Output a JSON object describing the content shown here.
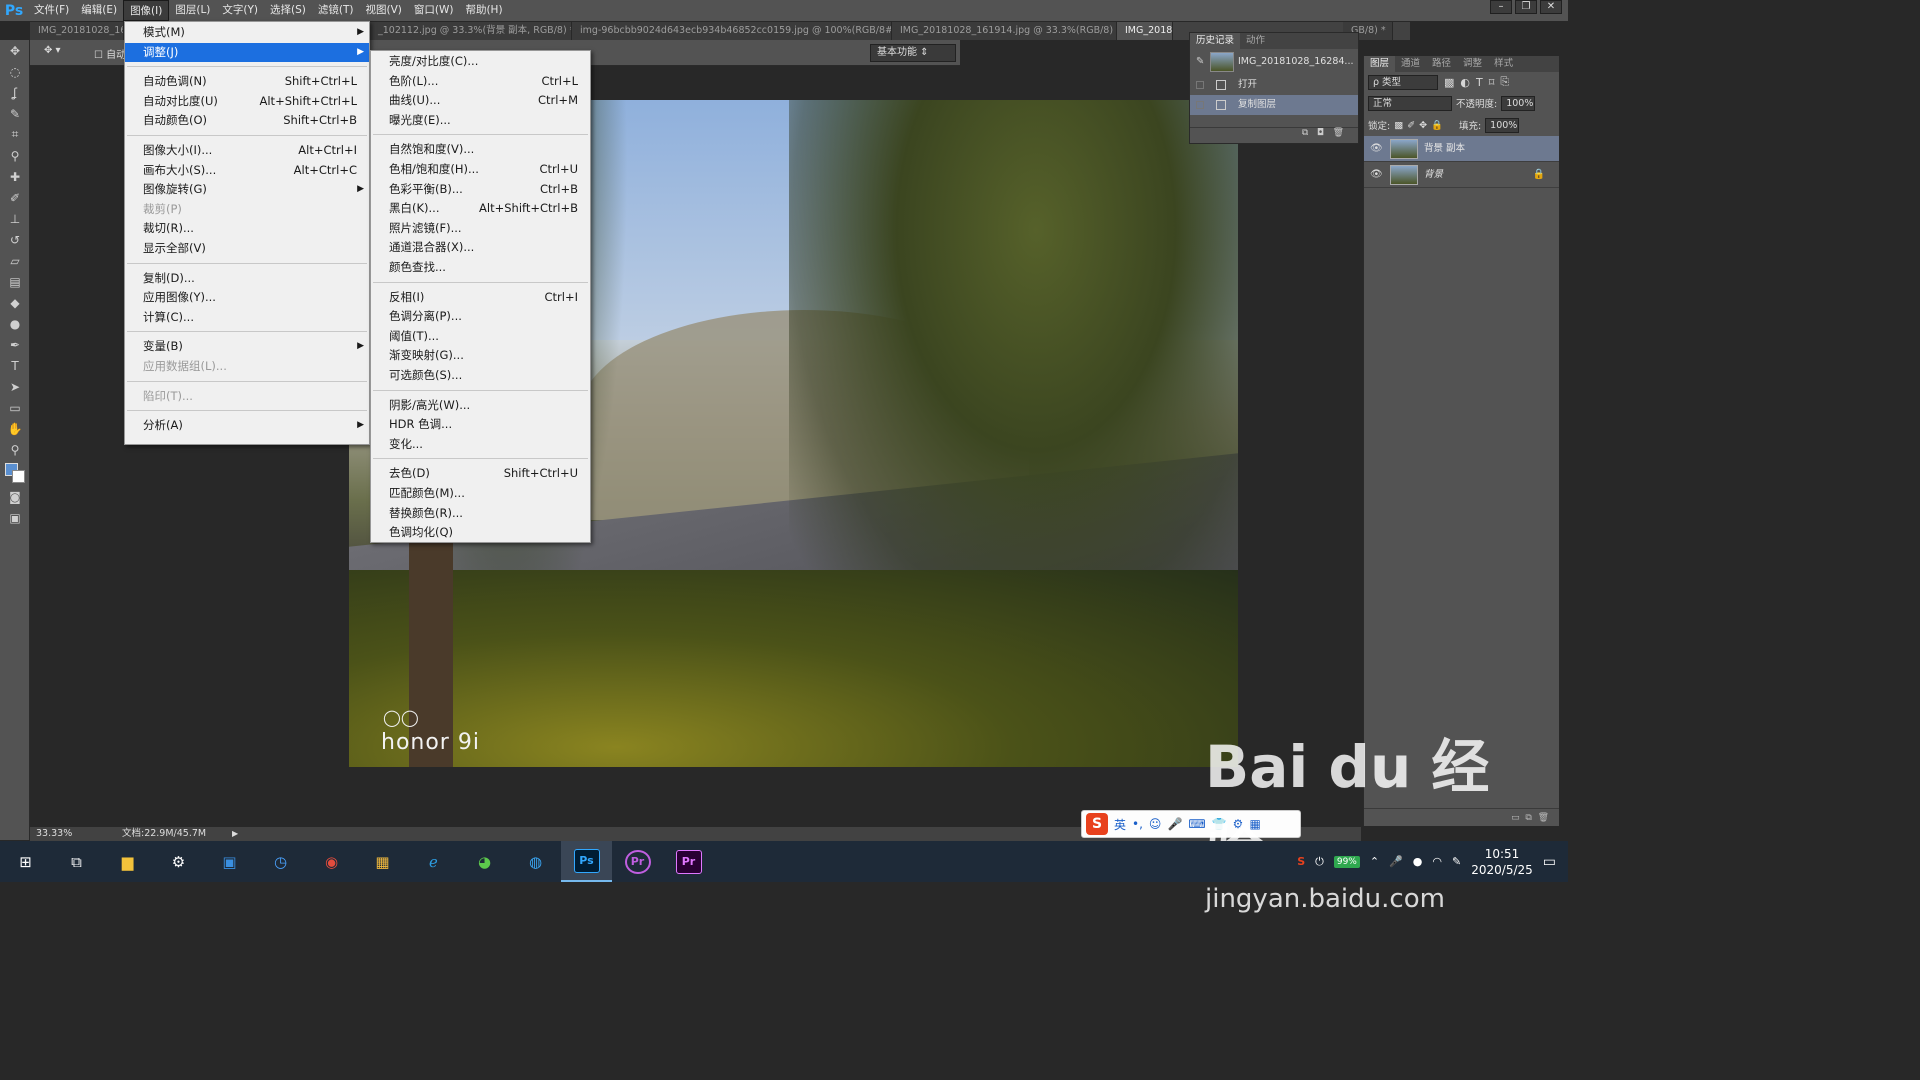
{
  "menubar": {
    "logo": "Ps",
    "items": [
      "文件(F)",
      "编辑(E)",
      "图像(I)",
      "图层(L)",
      "文字(Y)",
      "选择(S)",
      "滤镜(T)",
      "视图(V)",
      "窗口(W)",
      "帮助(H)"
    ],
    "window_controls": [
      "–",
      "❐",
      "✕"
    ]
  },
  "doc_tabs": [
    {
      "label": "IMG_20181028_16"
    },
    {
      "label": "_102112.jpg @ 33.3%(背景 副本, RGB/8) *",
      "close": "×"
    },
    {
      "label": "img-96bcbb9024d643ecb934b46852cc0159.jpg @ 100%(RGB/8#)",
      "close": "×"
    },
    {
      "label": "IMG_20181028_161914.jpg @ 33.3%(RGB/8)",
      "close": "×"
    },
    {
      "label": "IMG_20181028"
    },
    {
      "label": "GB/8) *",
      "close": "×"
    }
  ],
  "options": {
    "auto_select": "自动",
    "workspace": "基本功能"
  },
  "image_menu": {
    "items": [
      {
        "label": "模式(M)",
        "submenu": true
      },
      {
        "label": "调整(J)",
        "submenu": true,
        "highlight": true
      },
      {
        "label": "自动色调(N)",
        "shortcut": "Shift+Ctrl+L"
      },
      {
        "label": "自动对比度(U)",
        "shortcut": "Alt+Shift+Ctrl+L"
      },
      {
        "label": "自动颜色(O)",
        "shortcut": "Shift+Ctrl+B"
      },
      {
        "label": "图像大小(I)...",
        "shortcut": "Alt+Ctrl+I"
      },
      {
        "label": "画布大小(S)...",
        "shortcut": "Alt+Ctrl+C"
      },
      {
        "label": "图像旋转(G)",
        "submenu": true
      },
      {
        "label": "裁剪(P)",
        "disabled": true
      },
      {
        "label": "裁切(R)..."
      },
      {
        "label": "显示全部(V)"
      },
      {
        "label": "复制(D)..."
      },
      {
        "label": "应用图像(Y)..."
      },
      {
        "label": "计算(C)..."
      },
      {
        "label": "变量(B)",
        "submenu": true
      },
      {
        "label": "应用数据组(L)...",
        "disabled": true
      },
      {
        "label": "陷印(T)...",
        "disabled": true
      },
      {
        "label": "分析(A)",
        "submenu": true
      }
    ]
  },
  "adjust_menu": {
    "items": [
      {
        "label": "亮度/对比度(C)..."
      },
      {
        "label": "色阶(L)...",
        "shortcut": "Ctrl+L"
      },
      {
        "label": "曲线(U)...",
        "shortcut": "Ctrl+M"
      },
      {
        "label": "曝光度(E)..."
      },
      {
        "label": "自然饱和度(V)..."
      },
      {
        "label": "色相/饱和度(H)...",
        "shortcut": "Ctrl+U"
      },
      {
        "label": "色彩平衡(B)...",
        "shortcut": "Ctrl+B"
      },
      {
        "label": "黑白(K)...",
        "shortcut": "Alt+Shift+Ctrl+B"
      },
      {
        "label": "照片滤镜(F)..."
      },
      {
        "label": "通道混合器(X)..."
      },
      {
        "label": "颜色查找..."
      },
      {
        "label": "反相(I)",
        "shortcut": "Ctrl+I"
      },
      {
        "label": "色调分离(P)..."
      },
      {
        "label": "阈值(T)..."
      },
      {
        "label": "渐变映射(G)..."
      },
      {
        "label": "可选颜色(S)..."
      },
      {
        "label": "阴影/高光(W)..."
      },
      {
        "label": "HDR 色调..."
      },
      {
        "label": "变化..."
      },
      {
        "label": "去色(D)",
        "shortcut": "Shift+Ctrl+U"
      },
      {
        "label": "匹配颜色(M)..."
      },
      {
        "label": "替换颜色(R)..."
      },
      {
        "label": "色调均化(Q)"
      }
    ]
  },
  "history": {
    "tabs": [
      "历史记录",
      "动作"
    ],
    "snapshot": "IMG_20181028_16284...",
    "steps": [
      "打开",
      "复制图层"
    ]
  },
  "layers": {
    "tabs": [
      "图层",
      "通道",
      "路径",
      "调整",
      "样式"
    ],
    "filter": "ρ 类型",
    "blend_mode": "正常",
    "opacity_label": "不透明度:",
    "opacity": "100%",
    "lock_label": "锁定:",
    "fill_label": "填充:",
    "fill": "100%",
    "items": [
      {
        "name": "背景 副本",
        "selected": true
      },
      {
        "name": "背景",
        "locked": true
      }
    ]
  },
  "photo": {
    "brand": "honor 9i",
    "rings": "◯◯"
  },
  "status": {
    "zoom": "33.33%",
    "doc": "文档:22.9M/45.7M"
  },
  "ime": {
    "logo": "S",
    "items": [
      "英",
      "•,",
      "☺",
      "🎤",
      "⌨",
      "👕",
      "⚙",
      "▦"
    ]
  },
  "watermark": {
    "text": "Bai du 经验",
    "url": "jingyan.baidu.com"
  },
  "tray": {
    "battery": "99%",
    "time": "10:51",
    "date": "2020/5/25"
  },
  "colors": {
    "accent": "#1c6fe0",
    "ps_blue": "#31a8ff",
    "fg_color": "#5a8fd0"
  }
}
